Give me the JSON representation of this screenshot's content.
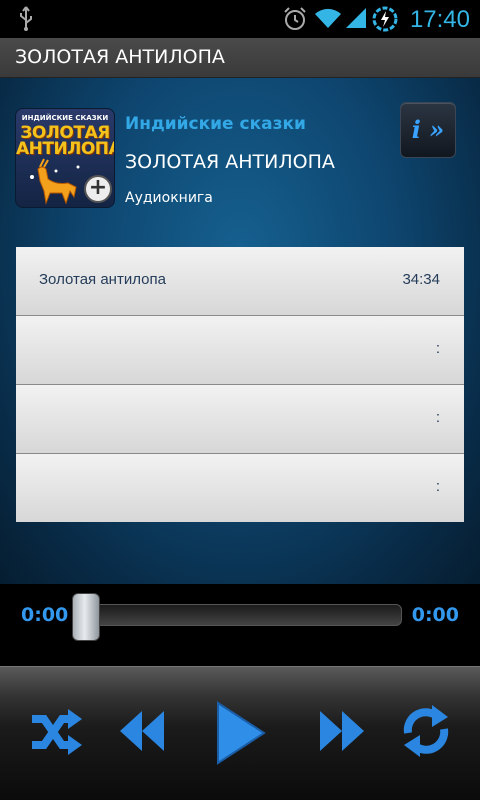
{
  "status_bar": {
    "time": "17:40",
    "icons": [
      "usb-icon",
      "alarm-icon",
      "wifi-icon",
      "signal-icon",
      "battery-charging-icon"
    ]
  },
  "title_bar": {
    "title": "ЗОЛОТАЯ АНТИЛОПА"
  },
  "book": {
    "cover": {
      "series": "ИНДИЙСКИЕ СКАЗКИ",
      "title_line1": "ЗОЛОТАЯ",
      "title_line2": "АНТИЛОПА"
    },
    "series": "Индийские сказки",
    "title": "ЗОЛОТАЯ АНТИЛОПА",
    "type": "Аудиокнига",
    "info_button": "i »"
  },
  "tracks": [
    {
      "name": "Золотая антилопа",
      "duration": "34:34"
    },
    {
      "name": "",
      "duration": ":"
    },
    {
      "name": "",
      "duration": ":"
    },
    {
      "name": "",
      "duration": ":"
    }
  ],
  "player": {
    "elapsed": "0:00",
    "total": "0:00",
    "progress": 0
  },
  "colors": {
    "accent": "#33b5e5",
    "control_blue": "#2a86e0"
  },
  "controls": [
    "shuffle-icon",
    "rewind-icon",
    "play-icon",
    "fast-forward-icon",
    "repeat-icon"
  ]
}
